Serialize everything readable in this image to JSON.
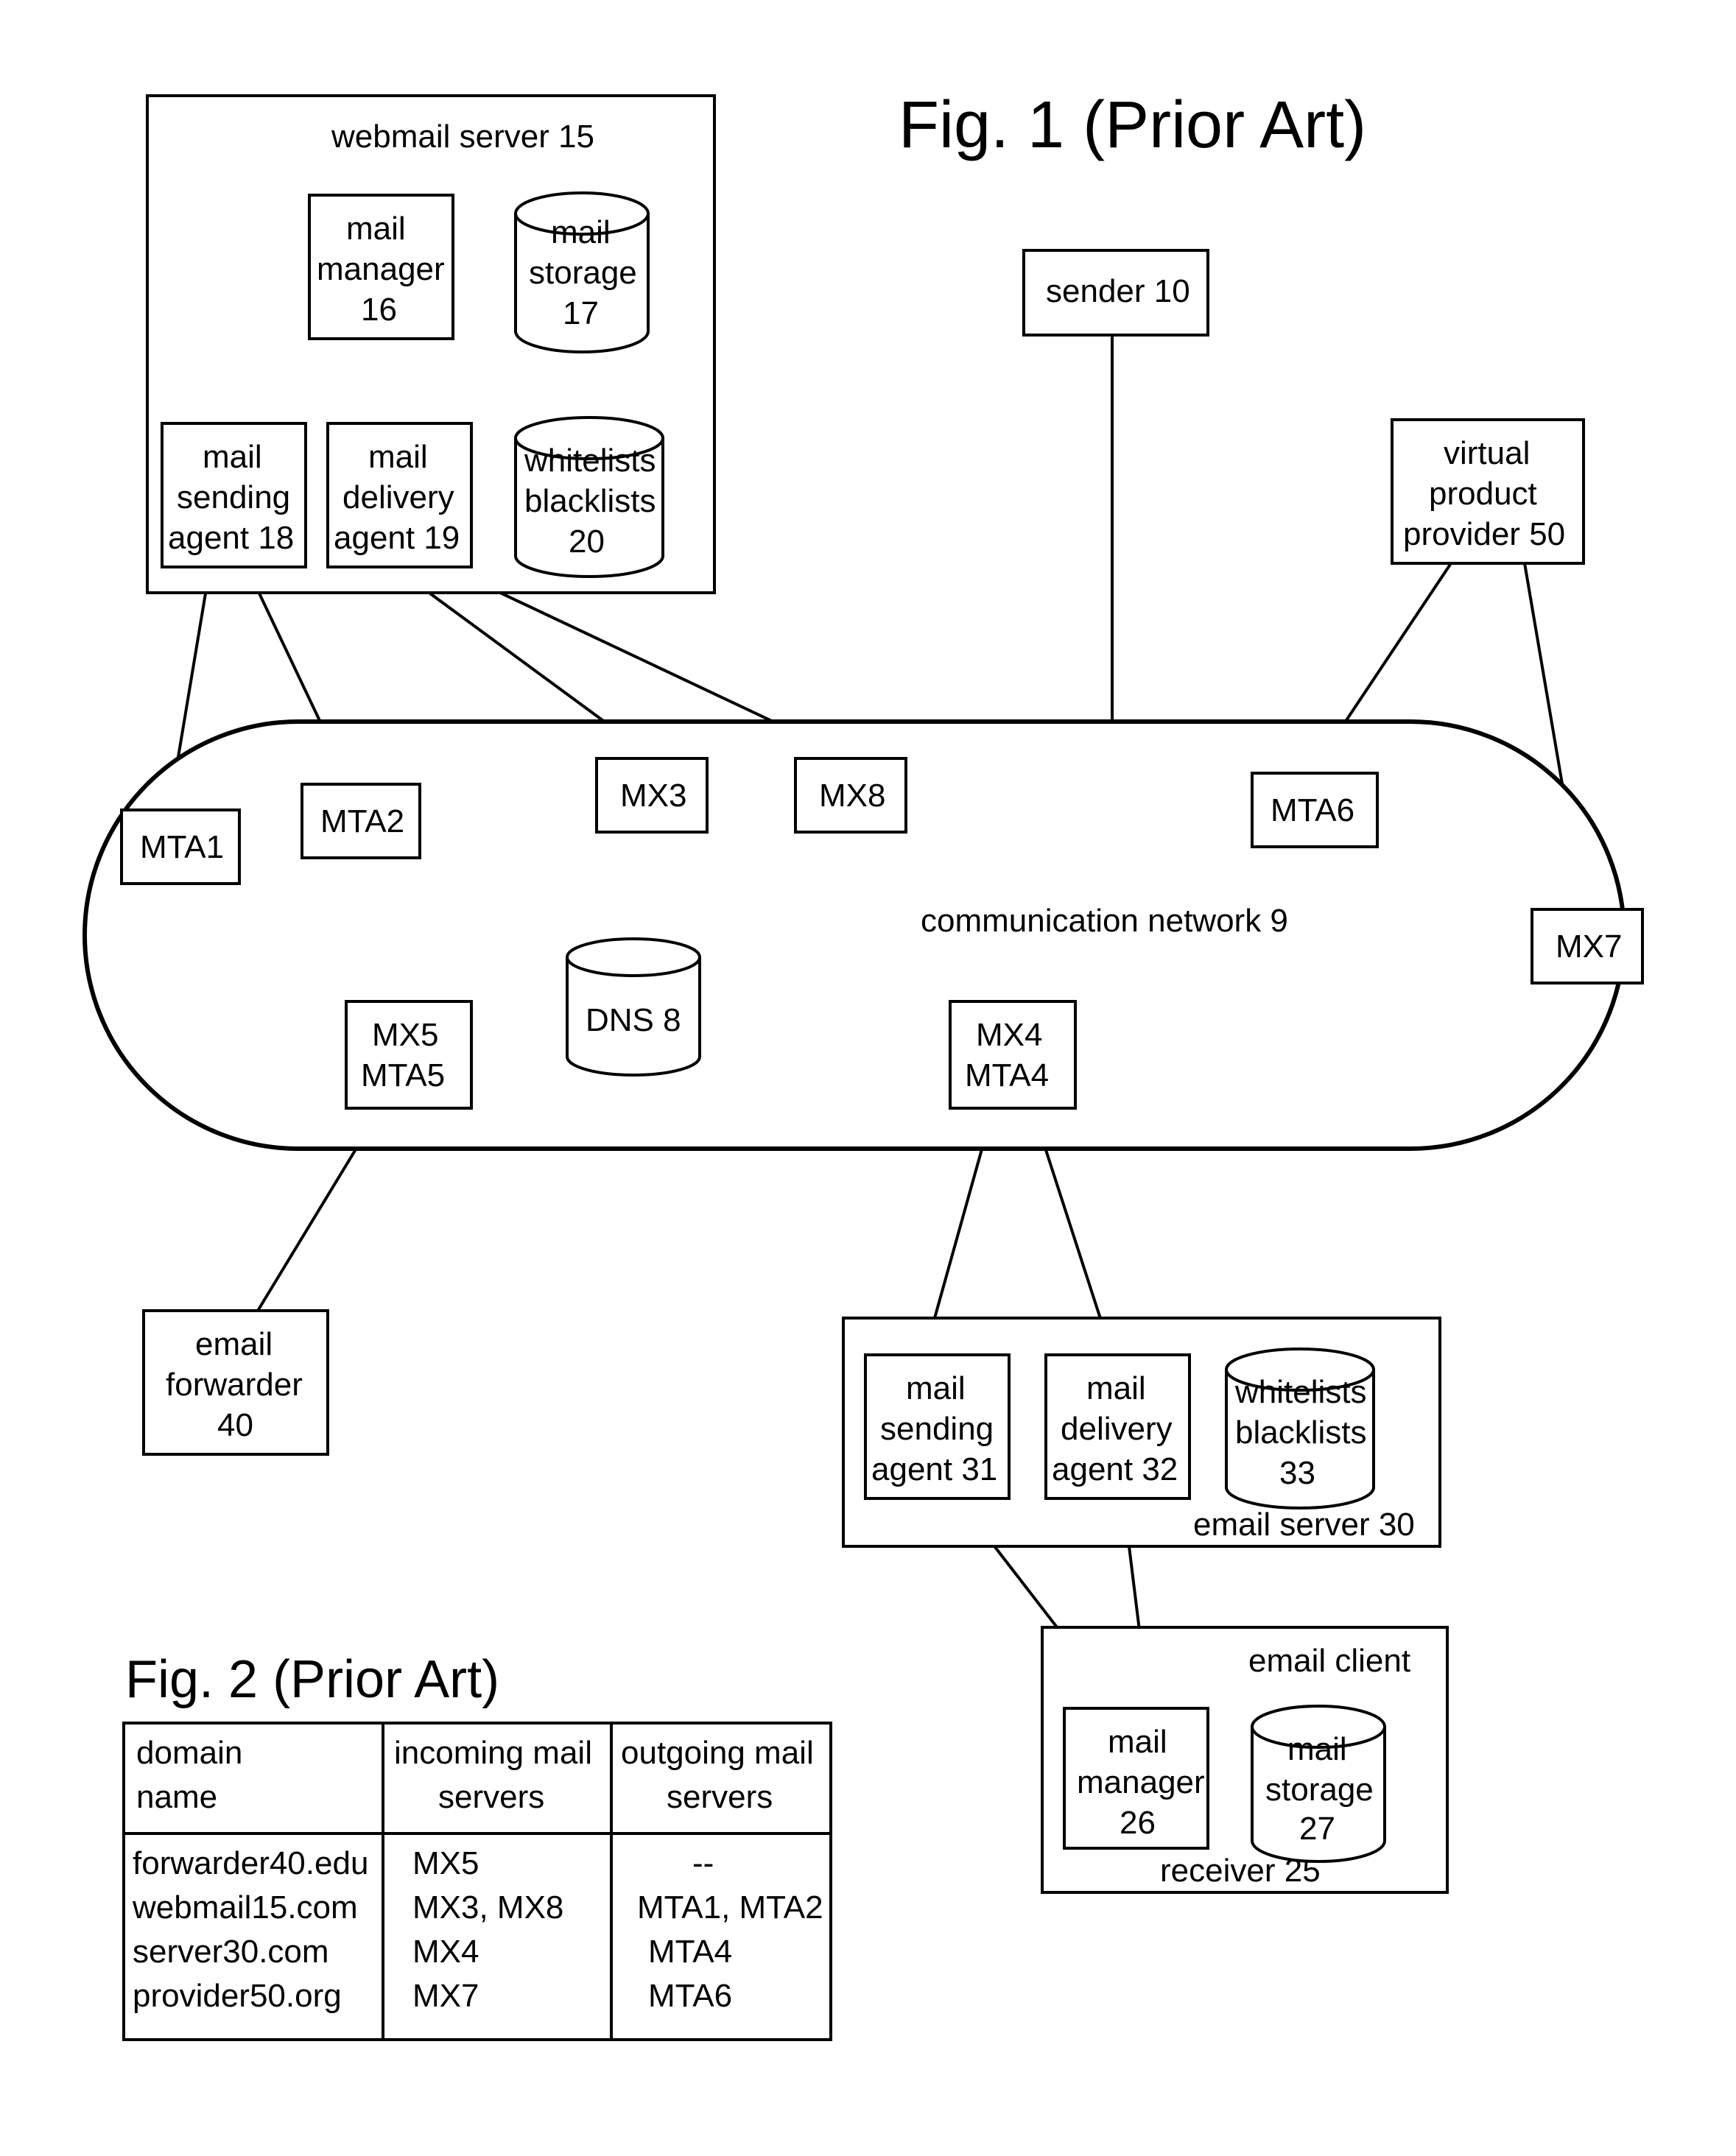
{
  "fig1": {
    "title": "Fig. 1 (Prior Art)",
    "webmail_server": "webmail server 15",
    "mail_manager_16": [
      "mail",
      "manager",
      "16"
    ],
    "mail_storage_17": [
      "mail",
      "storage",
      "17"
    ],
    "mail_sending_18": [
      "mail",
      "sending",
      "agent 18"
    ],
    "mail_delivery_19": [
      "mail",
      "delivery",
      "agent 19"
    ],
    "whitelists_20": [
      "whitelists",
      "blacklists",
      "20"
    ],
    "sender_10": "sender 10",
    "vpp_50": [
      "virtual",
      "product",
      "provider 50"
    ],
    "mta1": "MTA1",
    "mta2": "MTA2",
    "mx3": "MX3",
    "mx8": "MX8",
    "mta6": "MTA6",
    "mx7": "MX7",
    "dns8": "DNS 8",
    "comm_net": "communication network 9",
    "mx5_mta5": [
      "MX5",
      "MTA5"
    ],
    "mx4_mta4": [
      "MX4",
      "MTA4"
    ],
    "email_fwd_40": [
      "email",
      "forwarder",
      "40"
    ],
    "email_server_30": "email server 30",
    "mail_sending_31": [
      "mail",
      "sending",
      "agent 31"
    ],
    "mail_delivery_32": [
      "mail",
      "delivery",
      "agent 32"
    ],
    "whitelists_33": [
      "whitelists",
      "blacklists",
      "33"
    ],
    "email_client": "email client",
    "mail_manager_26": [
      "mail",
      "manager",
      "26"
    ],
    "mail_storage_27": [
      "mail",
      "storage",
      "27"
    ],
    "receiver_25": "receiver 25"
  },
  "fig2": {
    "title": "Fig. 2 (Prior Art)",
    "headers": [
      "domain\nname",
      "incoming mail\nservers",
      "outgoing mail\nservers"
    ],
    "rows": [
      [
        "forwarder40.edu",
        "MX5",
        "--"
      ],
      [
        "webmail15.com",
        "MX3, MX8",
        "MTA1, MTA2"
      ],
      [
        "server30.com",
        "MX4",
        "MTA4"
      ],
      [
        "provider50.org",
        "MX7",
        "MTA6"
      ]
    ]
  }
}
